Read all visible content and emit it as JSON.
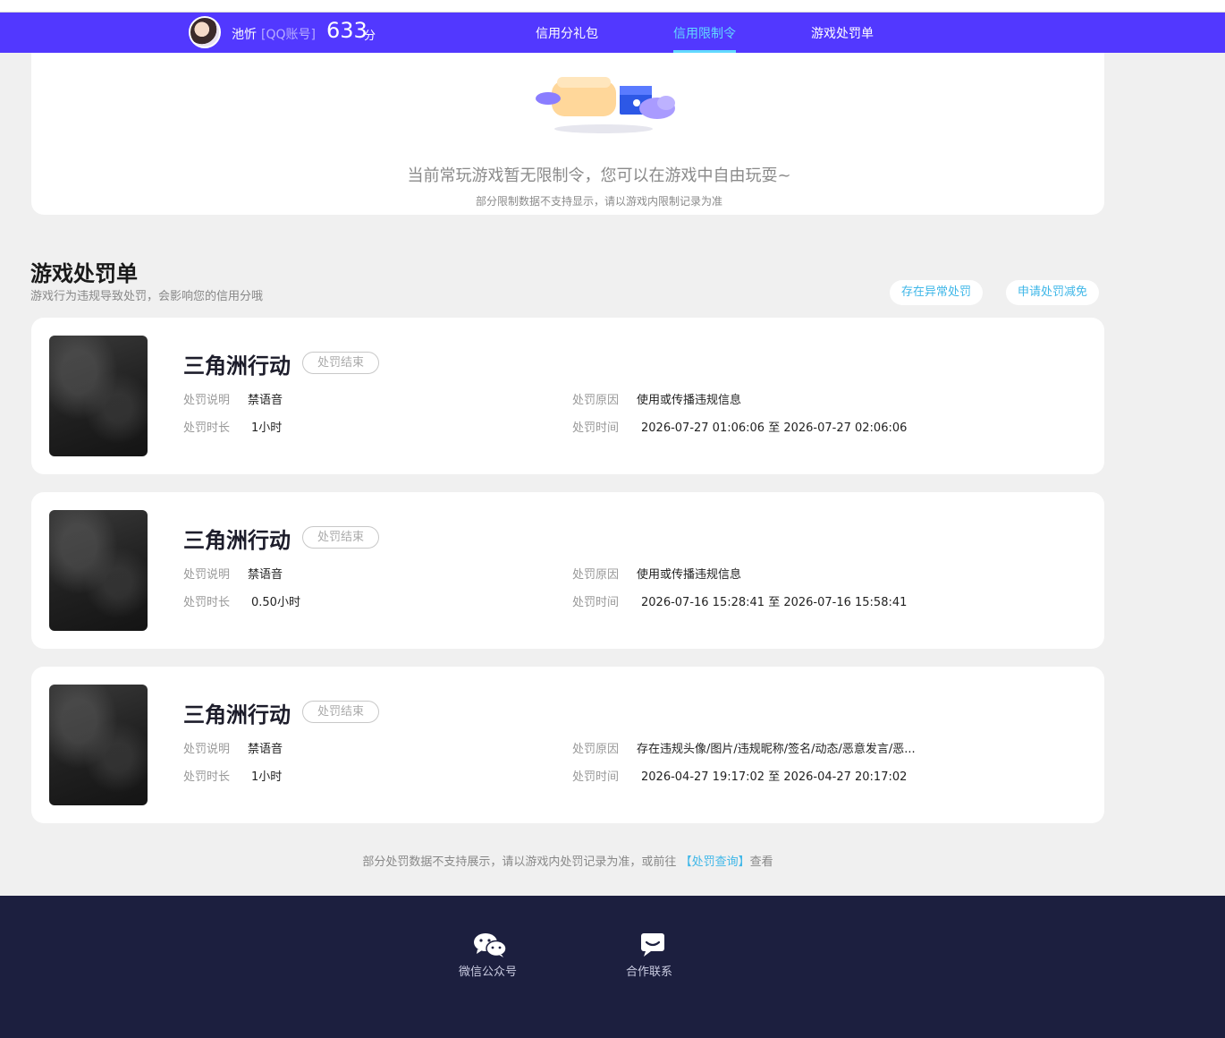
{
  "header": {
    "user_name": "池忻",
    "account_type": "[QQ账号]",
    "score": "633",
    "score_unit": "分",
    "tabs": [
      {
        "label": "信用分礼包",
        "active": false
      },
      {
        "label": "信用限制令",
        "active": true
      },
      {
        "label": "游戏处罚单",
        "active": false
      }
    ]
  },
  "restriction": {
    "message": "当前常玩游戏暂无限制令，您可以在游戏中自由玩耍~",
    "note": "部分限制数据不支持显示，请以游戏内限制记录为准"
  },
  "penalties": {
    "title": "游戏处罚单",
    "subtitle": "游戏行为违规导致处罚，会影响您的信用分哦",
    "abnormal_button": "存在异常处罚",
    "appeal_button": "申请处罚减免",
    "labels": {
      "desc": "处罚说明",
      "duration": "处罚时长",
      "reason": "处罚原因",
      "time": "处罚时间"
    },
    "items": [
      {
        "game": "三角洲行动",
        "status": "处罚结束",
        "desc": "禁语音",
        "duration": "1小时",
        "reason": "使用或传播违规信息",
        "time": "2026-07-27 01:06:06 至 2026-07-27 02:06:06"
      },
      {
        "game": "三角洲行动",
        "status": "处罚结束",
        "desc": "禁语音",
        "duration": "0.50小时",
        "reason": "使用或传播违规信息",
        "time": "2026-07-16 15:28:41 至 2026-07-16 15:58:41"
      },
      {
        "game": "三角洲行动",
        "status": "处罚结束",
        "desc": "禁语音",
        "duration": "1小时",
        "reason": "存在违规头像/图片/违规昵称/签名/动态/恶意发言/恶...",
        "time": "2026-04-27 19:17:02 至 2026-04-27 20:17:02"
      }
    ],
    "bottom_note_before": "部分处罚数据不支持展示，请以游戏内处罚记录为准，或前往",
    "bottom_note_link": "【处罚查询】",
    "bottom_note_after": "查看"
  },
  "footer": {
    "wechat_label": "微信公众号",
    "contact_label": "合作联系"
  },
  "colors": {
    "nav_bg": "#5238ff",
    "accent": "#62d9ff",
    "link": "#3fb7e8",
    "footer_bg": "#1c1f3f"
  }
}
